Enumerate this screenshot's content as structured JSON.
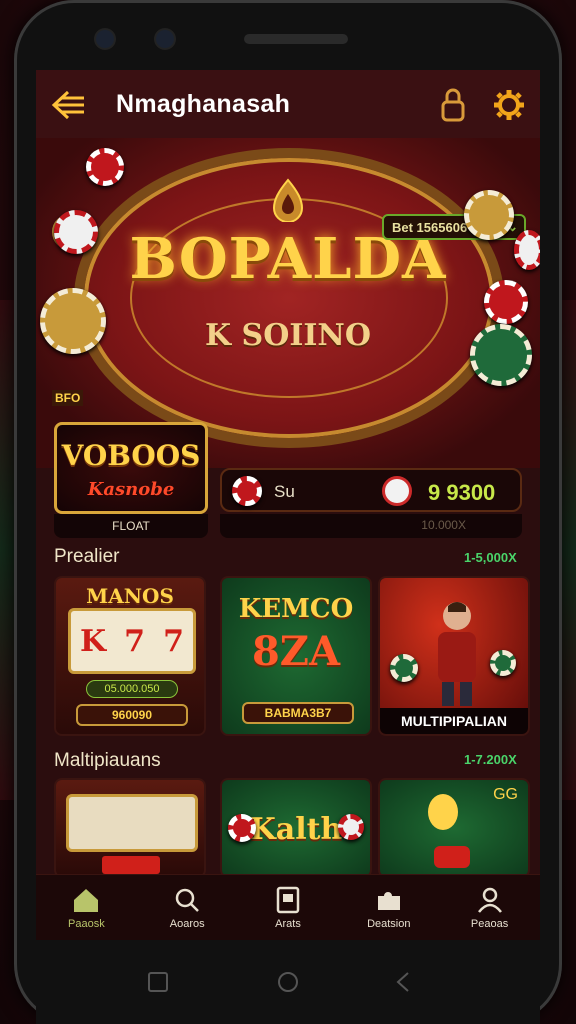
{
  "header": {
    "title": "Nmaghanasah",
    "back_icon": "back-arrow-icon",
    "right_icons": [
      "lock-icon",
      "gear-icon"
    ]
  },
  "hero": {
    "title": "BOPALDA",
    "subtitle": "K SOIINO",
    "balance": "Bet 1565606",
    "plus_label": "+"
  },
  "promo": {
    "label": "BFO",
    "line1": "VOBOOS",
    "line2": "Kasnobe",
    "footer": "FLOAT"
  },
  "wallet": {
    "label": "Su",
    "amount": "9 9300",
    "footer": "10.000X"
  },
  "sections": [
    {
      "title": "Prealier",
      "tag": "1-5,000X",
      "tiles": [
        {
          "name": "MANOS",
          "reels": [
            "K",
            "7",
            "7"
          ],
          "badge": "05.000.050",
          "button": "960090"
        },
        {
          "name": "KEMCO",
          "name2": "8ZA",
          "button": "BABMA3B7"
        },
        {
          "name": "",
          "caption": "MULTIPIPALIAN"
        }
      ]
    },
    {
      "title": "Maltipiauans",
      "tag": "1-7.200X",
      "tiles": [
        {
          "name": ""
        },
        {
          "name": "Kalth"
        },
        {
          "name": "GG"
        }
      ]
    }
  ],
  "bottom_nav": [
    {
      "label": "Paaosk",
      "icon": "home-icon",
      "active": true
    },
    {
      "label": "Aoaros",
      "icon": "search-icon",
      "active": false
    },
    {
      "label": "Arats",
      "icon": "card-icon",
      "active": false
    },
    {
      "label": "Deatsion",
      "icon": "puzzle-icon",
      "active": false
    },
    {
      "label": "Peaoas",
      "icon": "profile-icon",
      "active": false
    }
  ],
  "colors": {
    "accent": "#ffd34a",
    "header_bg": "#3a1012",
    "screen_bg": "#2b0d0e",
    "active_nav": "#b8c46a"
  }
}
